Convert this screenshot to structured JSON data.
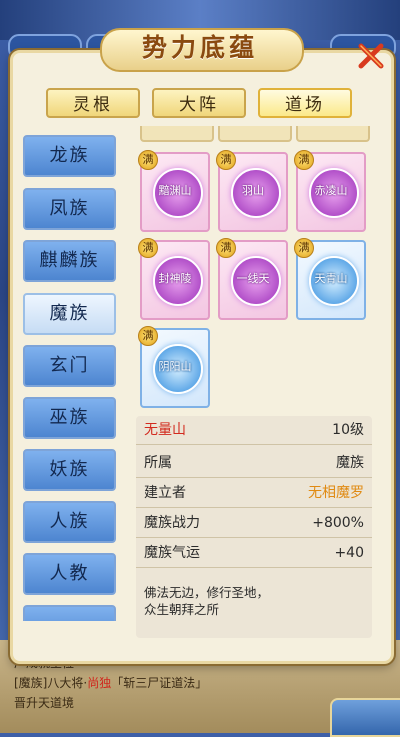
{
  "title": "势力底蕴",
  "tabs": [
    {
      "label": "灵根",
      "active": false
    },
    {
      "label": "大阵",
      "active": false
    },
    {
      "label": "道场",
      "active": true
    }
  ],
  "sidebar": {
    "items": [
      {
        "label": "龙族"
      },
      {
        "label": "凤族"
      },
      {
        "label": "麒麟族"
      },
      {
        "label": "魔族",
        "active": true
      },
      {
        "label": "玄门"
      },
      {
        "label": "巫族"
      },
      {
        "label": "妖族"
      },
      {
        "label": "人族"
      },
      {
        "label": "人教"
      }
    ]
  },
  "grid": {
    "badge": "满",
    "cards": [
      {
        "name": "黯渊山",
        "style": "pink"
      },
      {
        "name": "羽山",
        "style": "pink"
      },
      {
        "name": "赤凌山",
        "style": "pink"
      },
      {
        "name": "封神陵",
        "style": "pink"
      },
      {
        "name": "一线天",
        "style": "pink"
      },
      {
        "name": "天青山",
        "style": "blue"
      },
      {
        "name": "阴阳山",
        "style": "blue"
      }
    ]
  },
  "detail": {
    "name": "无量山",
    "level": "10级",
    "rows": [
      {
        "label": "所属",
        "value": "魔族"
      },
      {
        "label": "建立者",
        "value": "无相魔罗"
      },
      {
        "label": "魔族战力",
        "value": "+800%"
      },
      {
        "label": "魔族气运",
        "value": "+40"
      }
    ],
    "description": "佛法无边，修行圣地，\n众生朝拜之所"
  },
  "background": {
    "line1": "厂成就圣位",
    "line2_prefix": "[魔族]八大将·",
    "line2_highlight": "尚独",
    "line2_suffix": "「斩三尸证道法」",
    "line3": "晋升天道境"
  },
  "colors": {
    "accent_red": "#d22a1e",
    "accent_gold": "#e08a12",
    "sidebar_blue": "#4d85d0",
    "panel_bg": "#f5f0de"
  }
}
